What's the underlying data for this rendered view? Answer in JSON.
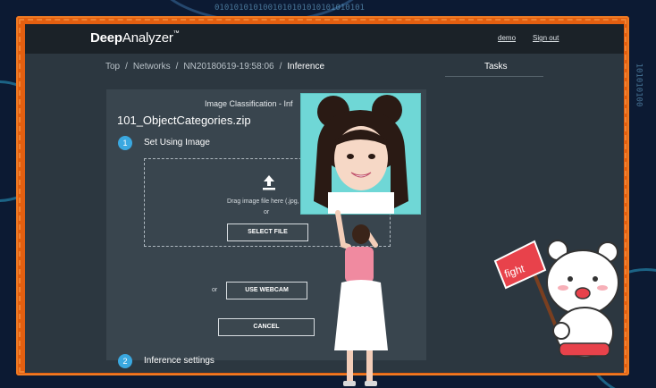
{
  "app": {
    "logo_bold": "Deep",
    "logo_light": "Analyzer",
    "logo_tm": "™",
    "nav_links": [
      "demo",
      "Sign out"
    ]
  },
  "breadcrumb": {
    "items": [
      "Top",
      "/",
      "Networks",
      "/",
      "NN20180619-19:58:06",
      "/"
    ],
    "current": "Inference"
  },
  "tasks": {
    "title": "Tasks"
  },
  "panel": {
    "title": "Image Classification - Inf",
    "zip_name": "101_ObjectCategories.zip",
    "step1": {
      "number": "1",
      "label": "Set Using Image"
    },
    "drop_text": "Drag image file here (.jpg, .gi",
    "or_1": "or",
    "select_file": "SELECT FILE",
    "or_2": "or",
    "use_webcam": "USE WEBCAM",
    "cancel": "CANCEL",
    "step2": {
      "number": "2",
      "label": "Inference settings"
    }
  },
  "overlay": {
    "sticker_text": "fight",
    "frame_color": "#e35f10",
    "accent_color": "#3aa8e0"
  }
}
